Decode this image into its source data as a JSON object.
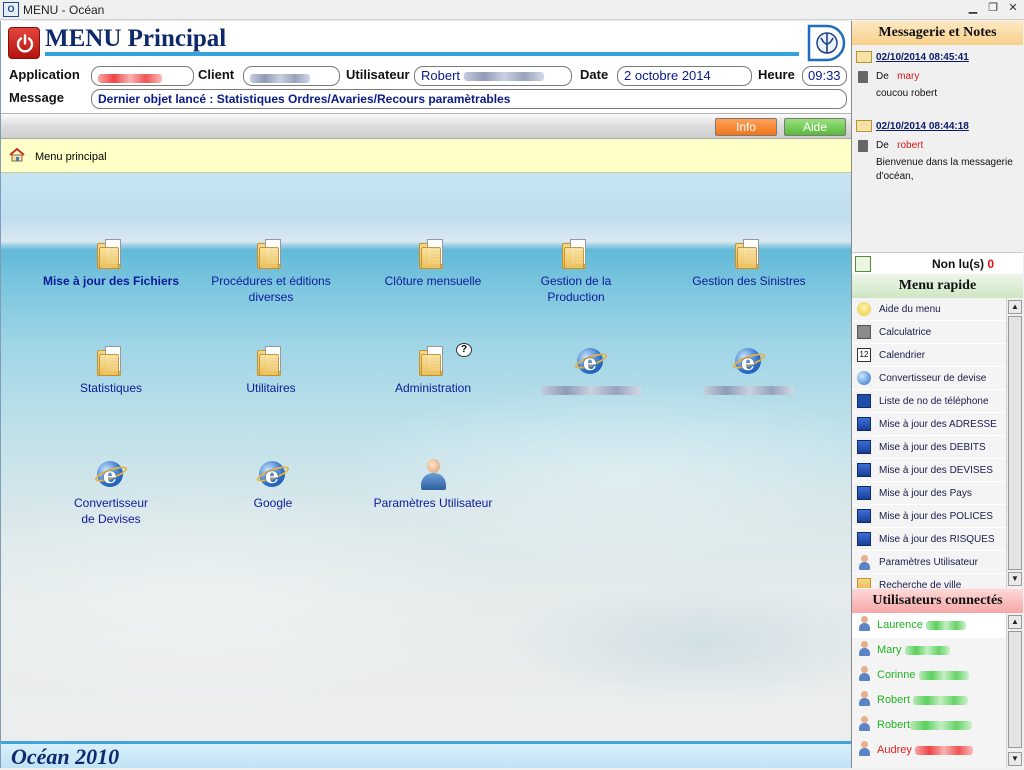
{
  "window": {
    "title": "MENU - Océan"
  },
  "header": {
    "title": "MENU Principal",
    "application_label": "Application",
    "client_label": "Client",
    "user_label": "Utilisateur",
    "user_value": "Robert",
    "date_label": "Date",
    "date_value": "2 octobre 2014",
    "time_label": "Heure",
    "time_value": "09:33",
    "message_label": "Message",
    "message_value": "Dernier objet lancé : Statistiques Ordres/Avaries/Recours paramètrables"
  },
  "toolbar": {
    "info_label": "Info",
    "aide_label": "Aide"
  },
  "breadcrumb": {
    "label": "Menu principal"
  },
  "desktop": {
    "items": [
      {
        "label": "Mise à jour des Fichiers",
        "icon": "folder-icon"
      },
      {
        "label": "Procédures et éditions diverses",
        "icon": "folder-icon"
      },
      {
        "label": "Clôture mensuelle",
        "icon": "folder-icon"
      },
      {
        "label": "Gestion de la Production",
        "icon": "folder-icon"
      },
      {
        "label": "Gestion des Sinistres",
        "icon": "folder-icon"
      },
      {
        "label": "Statistiques",
        "icon": "folder-icon"
      },
      {
        "label": "Utilitaires",
        "icon": "folder-icon"
      },
      {
        "label": "Administration",
        "icon": "folder-icon"
      },
      {
        "label": "",
        "icon": "ie-icon"
      },
      {
        "label": "",
        "icon": "ie-icon"
      },
      {
        "label": "Convertisseur de Devises",
        "icon": "ie-icon"
      },
      {
        "label": "Google",
        "icon": "ie-icon"
      },
      {
        "label": "Paramètres Utilisateur",
        "icon": "user-icon"
      }
    ]
  },
  "footer": {
    "label": "Océan 2010"
  },
  "messagerie": {
    "title": "Messagerie et Notes",
    "de_label": "De",
    "messages": [
      {
        "date": "02/10/2014 08:45:41",
        "from": "mary",
        "body": "coucou robert"
      },
      {
        "date": "02/10/2014 08:44:18",
        "from": "robert",
        "body": "Bienvenue dans la messagerie d'océan,"
      }
    ],
    "non_lus_label": "Non lu(s)",
    "non_lus_count": "0"
  },
  "menu_rapide": {
    "title": "Menu rapide",
    "items": [
      {
        "label": "Aide du menu",
        "icon": "lightbulb-icon"
      },
      {
        "label": "Calculatrice",
        "icon": "calculator-icon"
      },
      {
        "label": "Calendrier",
        "icon": "calendar-icon"
      },
      {
        "label": "Convertisseur de devise",
        "icon": "ie-icon"
      },
      {
        "label": "Liste de no de téléphone",
        "icon": "book-icon"
      },
      {
        "label": "Mise à jour des ADRESSE",
        "icon": "monitor-icon"
      },
      {
        "label": "Mise à jour des DEBITS",
        "icon": "monitor-icon"
      },
      {
        "label": "Mise à jour des DEVISES",
        "icon": "monitor-icon"
      },
      {
        "label": "Mise à jour des Pays",
        "icon": "monitor-icon"
      },
      {
        "label": "Mise à jour des POLICES",
        "icon": "monitor-icon"
      },
      {
        "label": "Mise à jour des RISQUES",
        "icon": "monitor-icon"
      },
      {
        "label": "Paramètres Utilisateur",
        "icon": "user-icon"
      },
      {
        "label": "Recherche de ville",
        "icon": "folder-icon"
      }
    ]
  },
  "utilisateurs": {
    "title": "Utilisateurs connectés",
    "items": [
      {
        "name": "Laurence",
        "status": "green"
      },
      {
        "name": "Mary",
        "status": "green"
      },
      {
        "name": "Corinne",
        "status": "green"
      },
      {
        "name": "Robert",
        "status": "green"
      },
      {
        "name": "Robert",
        "status": "green"
      },
      {
        "name": "Audrey",
        "status": "red"
      }
    ]
  },
  "colors": {
    "accent": "#33a3dd",
    "title": "#0e2a6c",
    "link": "#0c1a9a",
    "online": "#22b422",
    "offline": "#e82020"
  }
}
